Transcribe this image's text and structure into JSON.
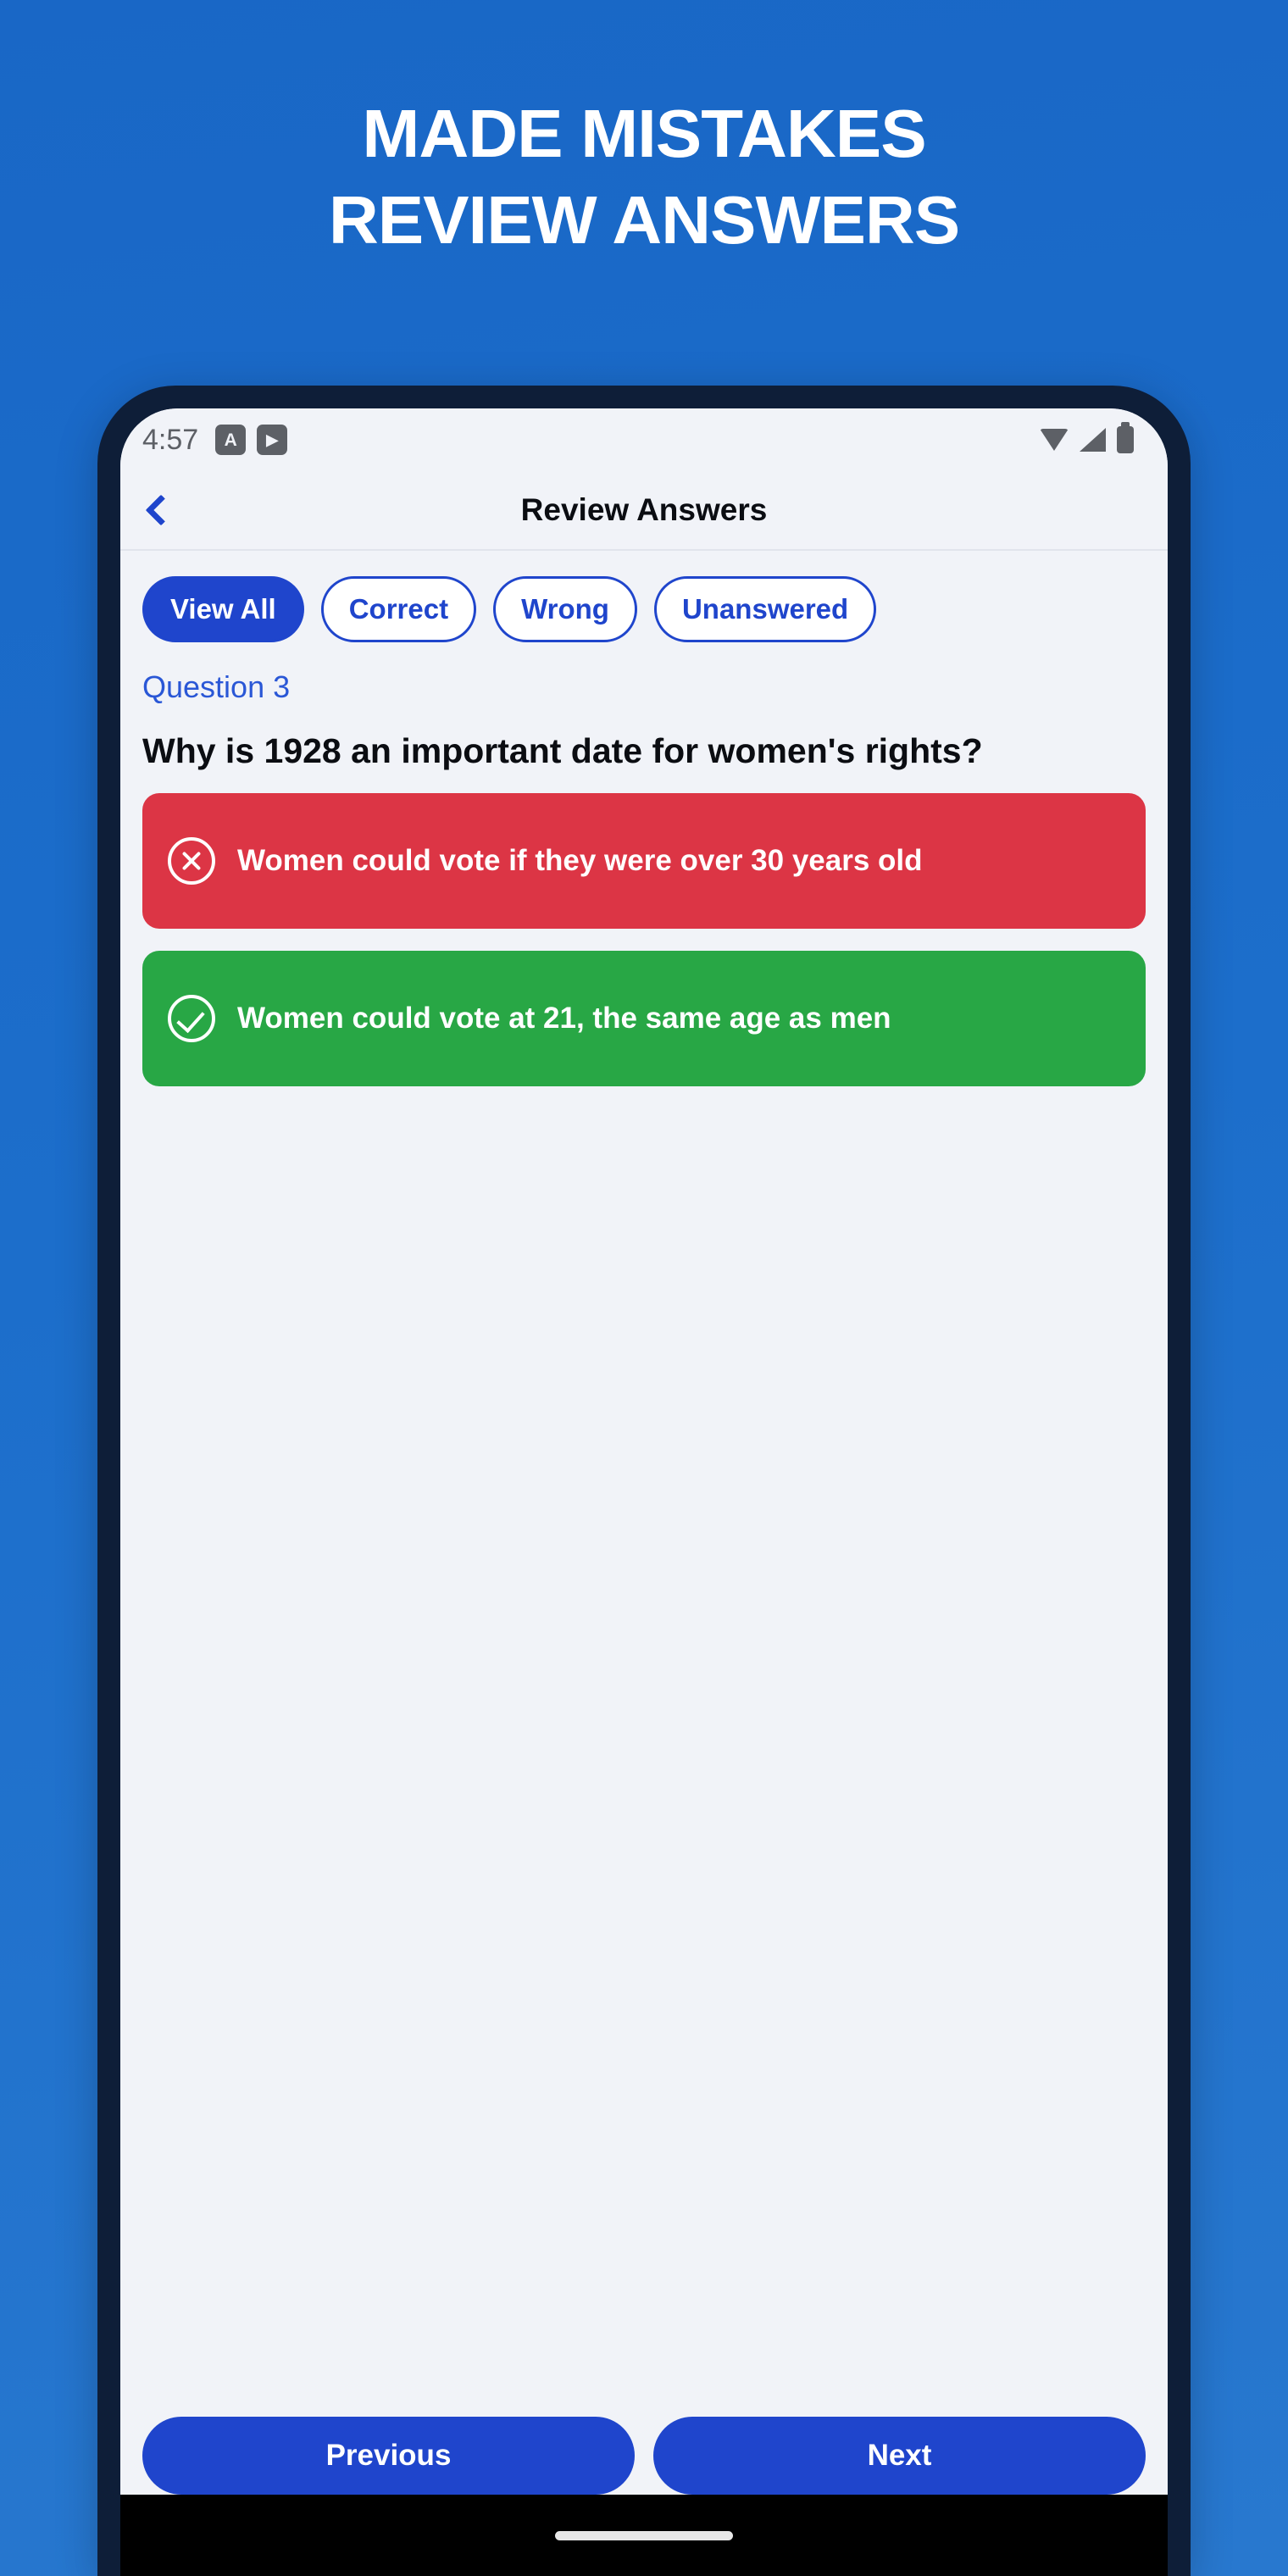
{
  "promo": {
    "background_color": "#1a69c4",
    "headline_lines": [
      "MADE MISTAKES",
      "REVIEW ANSWERS"
    ],
    "headline_color": "#ffffff"
  },
  "phone": {
    "frame_color": "#0e1e38",
    "screen_background": "#f1f3f8"
  },
  "status_bar": {
    "time": "4:57",
    "left_icons": [
      {
        "name": "font-size-badge-icon",
        "glyph": "A"
      },
      {
        "name": "play-badge-icon",
        "glyph": "▶"
      }
    ],
    "right_icons": [
      "wifi-icon",
      "signal-icon",
      "battery-icon"
    ]
  },
  "header": {
    "back_label": "‹",
    "title": "Review Answers",
    "accent_color": "#1f45cc"
  },
  "filters": [
    {
      "label": "View All",
      "active": true
    },
    {
      "label": "Correct",
      "active": false
    },
    {
      "label": "Wrong",
      "active": false
    },
    {
      "label": "Unanswered",
      "active": false
    }
  ],
  "question": {
    "number_label": "Question 3",
    "text": "Why is 1928 an important date for women's rights?"
  },
  "answers": [
    {
      "text": "Women could vote if they were over 30 years old",
      "state": "wrong",
      "icon": "x-circle-icon",
      "color": "#dc3545"
    },
    {
      "text": "Women could vote at 21, the same age as men",
      "state": "correct",
      "icon": "check-circle-icon",
      "color": "#28a745"
    }
  ],
  "footer": {
    "previous_label": "Previous",
    "next_label": "Next",
    "button_color": "#1f45cc"
  }
}
